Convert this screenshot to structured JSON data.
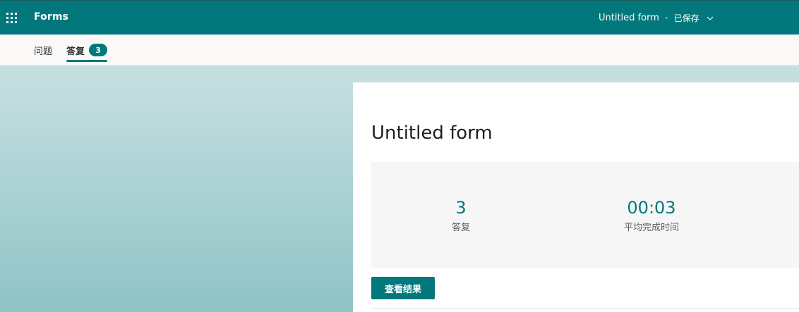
{
  "header": {
    "app_name": "Forms",
    "form_name": "Untitled form",
    "separator": "-",
    "save_status": "已保存",
    "icons": [
      "app-launcher-icon",
      "chevron-down-icon"
    ]
  },
  "tabs": [
    {
      "label": "问题",
      "active": false
    },
    {
      "label": "答复",
      "active": true,
      "badge": "3"
    }
  ],
  "form": {
    "title": "Untitled form",
    "stats": [
      {
        "value": "3",
        "label": "答复"
      },
      {
        "value": "00:03",
        "label": "平均完成时间"
      }
    ],
    "view_results_label": "查看结果"
  },
  "colors": {
    "brand": "#03787c",
    "canvas_top": "#c7e0e2",
    "canvas_bottom": "#8fc3c5",
    "stats_bg": "#f6f6f6"
  }
}
